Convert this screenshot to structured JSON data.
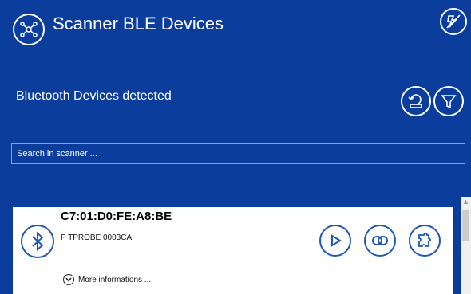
{
  "header": {
    "title": "Scanner BLE Devices",
    "app_icon": "network-hub-icon",
    "right_icon": "search-off-icon"
  },
  "section": {
    "title": "Bluetooth Devices detected",
    "actions": [
      "refresh-icon",
      "filter-icon"
    ]
  },
  "search": {
    "placeholder": "Search in scanner ..."
  },
  "device": {
    "mac": "C7:01:D0:FE:A8:BE",
    "name": "P TPROBE 0003CA",
    "more_label": "More informations ...",
    "actions": [
      "play-icon",
      "link-icon",
      "puzzle-icon"
    ]
  },
  "colors": {
    "background": "#0a3d9c",
    "accent": "#1f57b5",
    "card": "#ffffff"
  }
}
